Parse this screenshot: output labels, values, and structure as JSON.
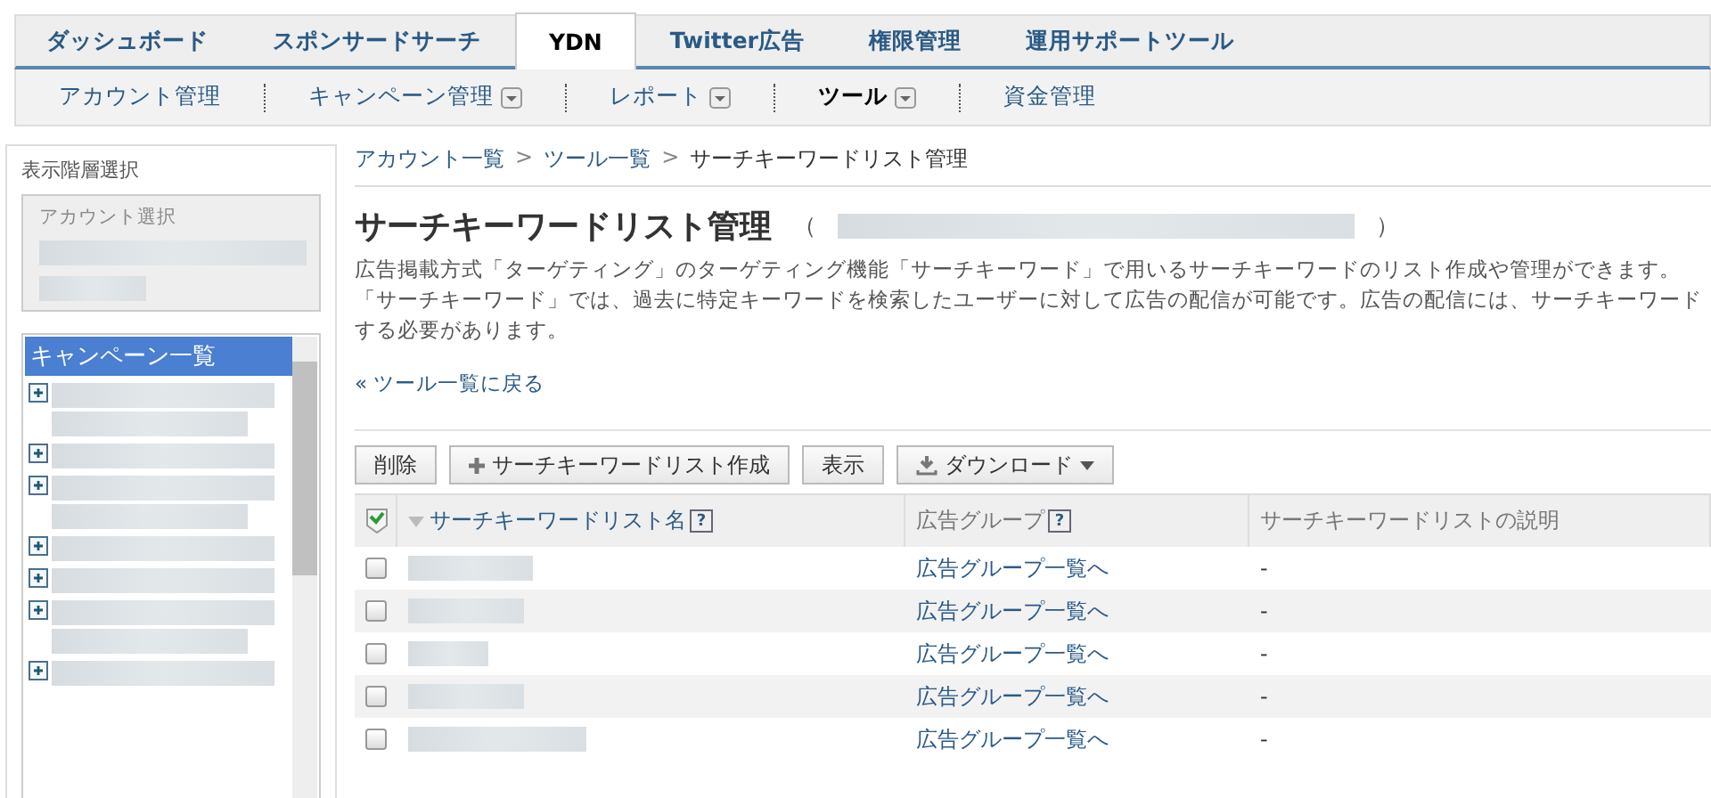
{
  "tabs": [
    {
      "label": "ダッシュボード",
      "selected": false
    },
    {
      "label": "スポンサードサーチ",
      "selected": false
    },
    {
      "label": "YDN",
      "selected": true
    },
    {
      "label": "Twitter広告",
      "selected": false
    },
    {
      "label": "権限管理",
      "selected": false
    },
    {
      "label": "運用サポートツール",
      "selected": false
    }
  ],
  "subnav": [
    {
      "label": "アカウント管理",
      "dropdown": false,
      "selected": false
    },
    {
      "label": "キャンペーン管理",
      "dropdown": true,
      "selected": false
    },
    {
      "label": "レポート",
      "dropdown": true,
      "selected": false
    },
    {
      "label": "ツール",
      "dropdown": true,
      "selected": true
    },
    {
      "label": "資金管理",
      "dropdown": false,
      "selected": false
    }
  ],
  "sidebar": {
    "heading": "表示階層選択",
    "account_label": "アカウント選択",
    "tree_title": "キャンペーン一覧",
    "tree_items": [
      {
        "expanded": false
      },
      {
        "expanded": false
      },
      {
        "expanded": false
      },
      {
        "expanded": false
      },
      {
        "expanded": false
      },
      {
        "expanded": false
      },
      {
        "expanded": false
      }
    ]
  },
  "breadcrumb": [
    {
      "label": "アカウント一覧",
      "link": true
    },
    {
      "label": "ツール一覧",
      "link": true
    },
    {
      "label": "サーチキーワードリスト管理",
      "link": false
    }
  ],
  "breadcrumb_separator": ">",
  "title": "サーチキーワードリスト管理",
  "title_open": "（",
  "title_close": "）",
  "description": [
    "広告掲載方式「ターゲティング」のターゲティング機能「サーチキーワード」で用いるサーチキーワードのリスト作成や管理ができます。",
    "「サーチキーワード」では、過去に特定キーワードを検索したユーザーに対して広告の配信が可能です。広告の配信には、サーチキーワード",
    "する必要があります。"
  ],
  "back_link": "« ツール一覧に戻る",
  "toolbar": [
    {
      "label": "削除",
      "kind": "plain"
    },
    {
      "label": "サーチキーワードリスト作成",
      "kind": "add"
    },
    {
      "label": "表示",
      "kind": "plain"
    },
    {
      "label": "ダウンロード",
      "kind": "download"
    }
  ],
  "table": {
    "columns": [
      {
        "label": "サーチキーワードリスト名",
        "help": "?",
        "link": true
      },
      {
        "label": "広告グループ",
        "help": "?",
        "link": false
      },
      {
        "label": "サーチキーワードリストの説明",
        "link": false
      }
    ],
    "rows": [
      {
        "checked": false,
        "ad_group": "広告グループ一覧へ",
        "description": "-"
      },
      {
        "checked": false,
        "ad_group": "広告グループ一覧へ",
        "description": "-"
      },
      {
        "checked": false,
        "ad_group": "広告グループ一覧へ",
        "description": "-"
      },
      {
        "checked": false,
        "ad_group": "広告グループ一覧へ",
        "description": "-"
      },
      {
        "checked": false,
        "ad_group": "広告グループ一覧へ",
        "description": "-"
      }
    ]
  }
}
